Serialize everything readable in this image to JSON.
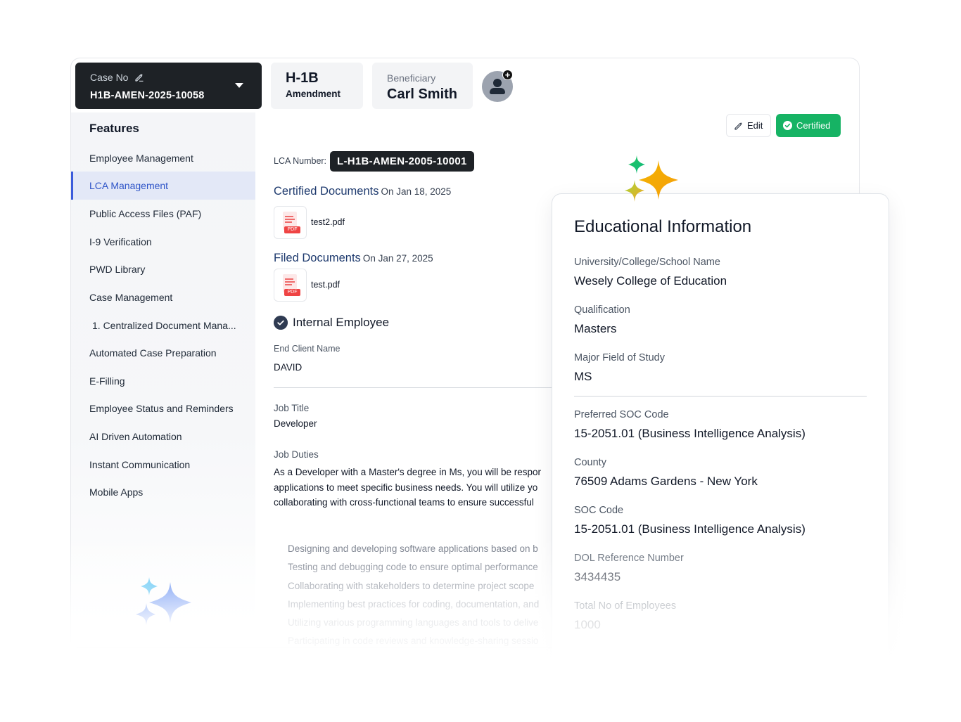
{
  "header": {
    "case_label": "Case No",
    "case_number": "H1B-AMEN-2025-10058",
    "visa_type": "H-1B",
    "visa_subtype": "Amendment",
    "beneficiary_label": "Beneficiary",
    "beneficiary_name": "Carl Smith"
  },
  "sidebar": {
    "title": "Features",
    "items": [
      {
        "label": "Employee Management"
      },
      {
        "label": "LCA Management"
      },
      {
        "label": "Public Access Files (PAF)"
      },
      {
        "label": "I-9 Verification"
      },
      {
        "label": "PWD Library"
      },
      {
        "label": "Case Management"
      },
      {
        "label": "1. Centralized Document Mana..."
      },
      {
        "label": "Automated Case Preparation"
      },
      {
        "label": "E-Filling"
      },
      {
        "label": "Employee Status and Reminders"
      },
      {
        "label": "AI Driven Automation"
      },
      {
        "label": "Instant Communication"
      },
      {
        "label": "Mobile Apps"
      }
    ]
  },
  "actions": {
    "edit_label": "Edit",
    "status_label": "Certified"
  },
  "lca": {
    "label": "LCA Number:",
    "value": "L-H1B-AMEN-2005-10001"
  },
  "certified_docs": {
    "title": "Certified Documents",
    "date": "On Jan 18, 2025",
    "file": "test2.pdf",
    "file_tag": "PDF"
  },
  "filed_docs": {
    "title": "Filed Documents",
    "date": "On Jan 27, 2025",
    "file": "test.pdf",
    "file_tag": "PDF"
  },
  "employee": {
    "internal_label": "Internal Employee",
    "end_client_label": "End Client Name",
    "end_client_value": "DAVID",
    "job_title_label": "Job Title",
    "job_title_value": "Developer",
    "job_duties_label": "Job Duties",
    "job_duties_lines": [
      "As a Developer with a Master's degree in Ms, you will be respor",
      "applications to meet specific business needs. You will utilize yo",
      "collaborating with cross-functional teams to ensure successful"
    ],
    "duties_bullets": [
      "Designing and developing software applications based on b",
      "Testing and debugging code to ensure optimal performance",
      "Collaborating with stakeholders to determine project scope",
      "Implementing best practices for coding, documentation, and",
      "Utilizing various programming languages and tools to delive",
      "Participating in code reviews and knowledge-sharing sessio"
    ]
  },
  "education": {
    "title": "Educational Information",
    "fields": [
      {
        "label": "University/College/School Name",
        "value": "Wesely College of Education"
      },
      {
        "label": "Qualification",
        "value": "Masters"
      },
      {
        "label": "Major Field of Study",
        "value": "MS"
      },
      {
        "label": "Preferred SOC Code",
        "value": "15-2051.01 (Business Intelligence Analysis)"
      },
      {
        "label": "County",
        "value": "76509 Adams Gardens - New York"
      },
      {
        "label": "SOC Code",
        "value": "15-2051.01 (Business Intelligence Analysis)"
      },
      {
        "label": "DOL Reference Number",
        "value": "3434435"
      },
      {
        "label": "Total No of Employees",
        "value": "1000"
      }
    ]
  },
  "colors": {
    "accent": "#3b5bdb",
    "certified_green": "#16b364",
    "dark_panel": "#1e2226",
    "section_title": "#1e3a6e"
  },
  "icons": [
    "pencil-icon",
    "caret-down-icon",
    "avatar-icon",
    "plus-icon",
    "check-circle-icon",
    "pdf-icon",
    "sparkle-icon"
  ]
}
